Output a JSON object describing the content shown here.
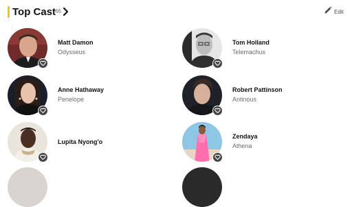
{
  "section": {
    "title": "Top Cast",
    "count": "46",
    "edit_label": "Edit",
    "accent_color": "#f5c518"
  },
  "icons": {
    "more": "chevron-right-icon",
    "edit": "pencil-icon",
    "like": "heart-outline-icon"
  },
  "cast": [
    {
      "name": "Matt Damon",
      "character": "Odysseus"
    },
    {
      "name": "Tom Holland",
      "character": "Telemachus"
    },
    {
      "name": "Anne Hathaway",
      "character": "Penelope"
    },
    {
      "name": "Robert Pattinson",
      "character": "Antinous"
    },
    {
      "name": "Lupita Nyong'o",
      "character": ""
    },
    {
      "name": "Zendaya",
      "character": "Athena"
    }
  ]
}
